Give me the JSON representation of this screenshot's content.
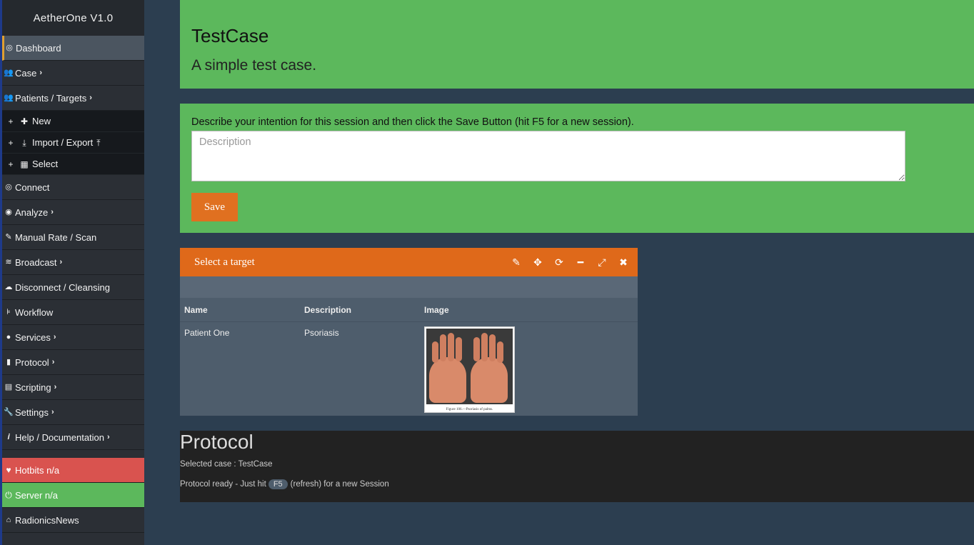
{
  "sidebar": {
    "brand": "AetherOne V1.0",
    "items": [
      {
        "label": "Dashboard",
        "icon": "dashboard-icon"
      },
      {
        "label": "Case",
        "icon": "users-icon"
      },
      {
        "label": "Patients / Targets",
        "icon": "users-icon"
      }
    ],
    "sub_items": [
      {
        "plus": "+",
        "label": "New",
        "icon": "plus-icon"
      },
      {
        "plus": "+",
        "label": "Import / Export",
        "icon": "download-icon",
        "icon2": "upload-icon"
      },
      {
        "plus": "+",
        "label": "Select",
        "icon": "grid-icon"
      }
    ],
    "items2": [
      {
        "label": "Connect",
        "icon": "target-icon"
      },
      {
        "label": "Analyze",
        "icon": "eye-icon"
      },
      {
        "label": "Manual Rate / Scan",
        "icon": "pencil-icon"
      },
      {
        "label": "Broadcast",
        "icon": "wifi-icon"
      },
      {
        "label": "Disconnect / Cleansing",
        "icon": "cloud-icon"
      },
      {
        "label": "Workflow",
        "icon": "workflow-icon"
      },
      {
        "label": "Services",
        "icon": "globe-icon"
      },
      {
        "label": "Protocol",
        "icon": "book-icon"
      },
      {
        "label": "Scripting",
        "icon": "script-icon"
      },
      {
        "label": "Settings",
        "icon": "wrench-icon"
      },
      {
        "label": "Help / Documentation",
        "icon": "info-icon"
      }
    ],
    "hotbits": "Hotbits n/a",
    "server": "Server n/a",
    "news": "RadionicsNews"
  },
  "header": {
    "title": "TestCase",
    "subtitle": "A simple test case."
  },
  "session": {
    "prompt": "Describe your intention for this session and then click the Save Button (hit F5 for a new session).",
    "description_placeholder": "Description",
    "description_value": "",
    "save_label": "Save"
  },
  "target_panel": {
    "title": "Select a target",
    "columns": [
      "Name",
      "Description",
      "Image"
    ],
    "rows": [
      {
        "name": "Patient One",
        "description": "Psoriasis",
        "image_caption": "Figure 106.—Psoriasis of palms."
      }
    ]
  },
  "protocol": {
    "title": "Protocol",
    "selected_case": "Selected case : TestCase",
    "ready_prefix": "Protocol ready - Just hit",
    "key": "F5",
    "ready_suffix": "(refresh) for a new Session"
  },
  "colors": {
    "green": "#5cb85c",
    "orange": "#df691a",
    "red": "#d9534f",
    "background": "#2c3e50",
    "sidebar": "#2b2f35"
  }
}
